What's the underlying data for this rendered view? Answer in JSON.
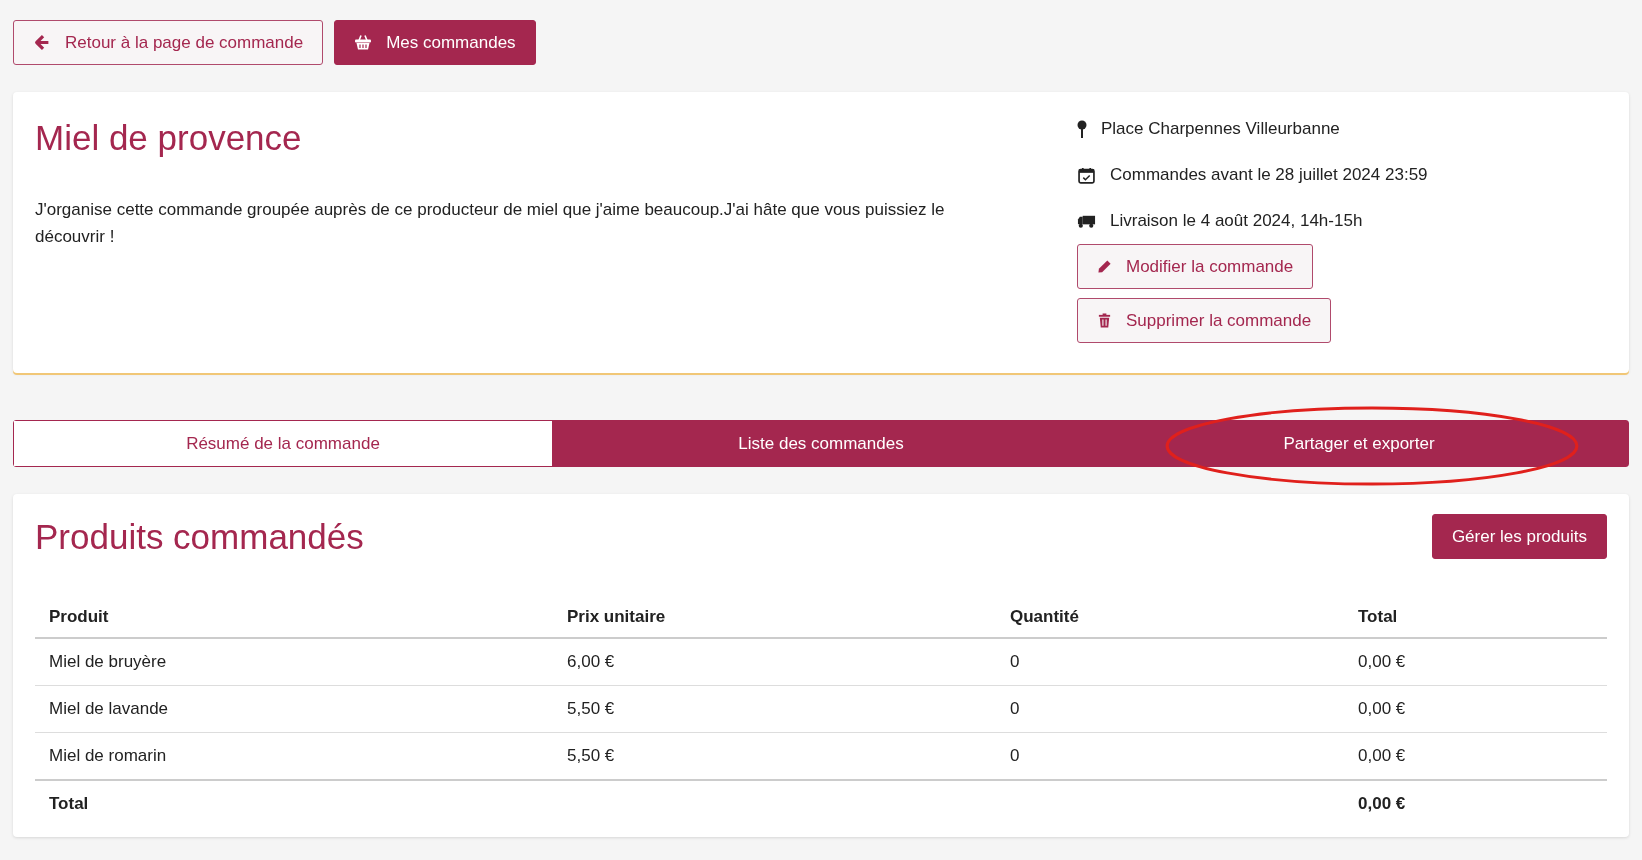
{
  "top_buttons": [
    {
      "kind": "back",
      "label": "Retour à la page de commande",
      "filled": false
    },
    {
      "kind": "basket",
      "label": "Mes commandes",
      "filled": true
    }
  ],
  "order": {
    "title": "Miel de provence",
    "description": "J'organise cette commande groupée auprès de ce producteur de miel que j'aime beaucoup.J'ai hâte que vous puissiez le découvrir !",
    "details": [
      {
        "kind": "location",
        "text": "Place Charpennes Villeurbanne"
      },
      {
        "kind": "calendar",
        "text": "Commandes avant le 28 juillet 2024 23:59"
      },
      {
        "kind": "truck",
        "text": "Livraison le 4 août 2024, 14h-15h"
      }
    ],
    "actions": [
      {
        "kind": "edit",
        "label": "Modifier la commande"
      },
      {
        "kind": "delete",
        "label": "Supprimer la commande"
      }
    ]
  },
  "tabs": [
    {
      "label": "Résumé de la commande",
      "selected": true
    },
    {
      "label": "Liste des commandes",
      "selected": false
    },
    {
      "label": "Partager et exporter",
      "selected": false
    }
  ],
  "products": {
    "title": "Produits commandés",
    "manage_button": "Gérer les produits",
    "columns": [
      "Produit",
      "Prix unitaire",
      "Quantité",
      "Total"
    ],
    "rows": [
      [
        "Miel de bruyère",
        "6,00 €",
        "0",
        "0,00 €"
      ],
      [
        "Miel de lavande",
        "5,50 €",
        "0",
        "0,00 €"
      ],
      [
        "Miel de romarin",
        "5,50 €",
        "0",
        "0,00 €"
      ]
    ],
    "footer": {
      "label": "Total",
      "total": "0,00 €"
    }
  }
}
